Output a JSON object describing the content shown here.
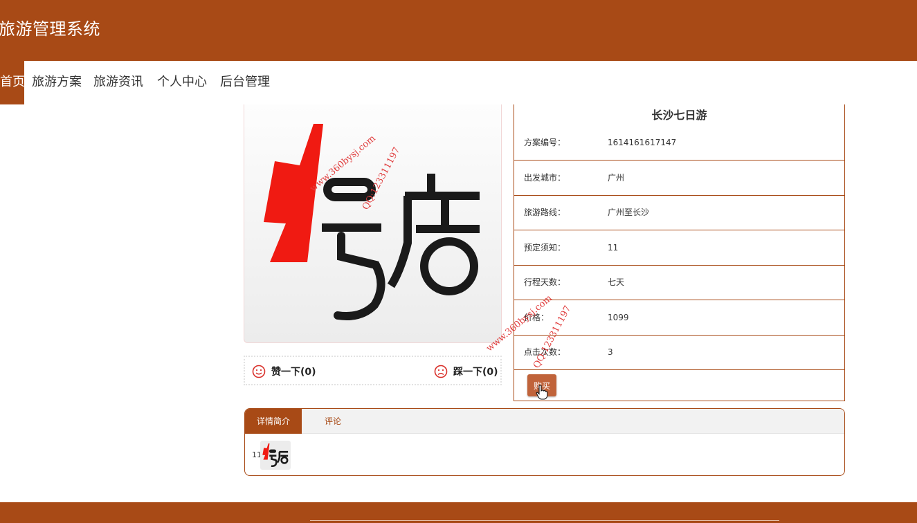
{
  "header": {
    "site_title": "旅游管理系统",
    "accent_color": "#a84a16"
  },
  "nav": {
    "items": [
      {
        "label": "首页",
        "active": true
      },
      {
        "label": "旅游方案",
        "active": false
      },
      {
        "label": "旅游资讯",
        "active": false
      },
      {
        "label": "个人中心",
        "active": false
      },
      {
        "label": "后台管理",
        "active": false
      }
    ]
  },
  "product": {
    "title": "长沙七日游",
    "image_logo": "1号店",
    "fields": [
      {
        "label": "方案编号：",
        "value": "1614161617147"
      },
      {
        "label": "出发城市：",
        "value": "广州"
      },
      {
        "label": "旅游路线：",
        "value": "广州至长沙"
      },
      {
        "label": "预定须知：",
        "value": "11"
      },
      {
        "label": "行程天数：",
        "value": "七天"
      },
      {
        "label": "价格：",
        "value": "1099"
      },
      {
        "label": "点击次数：",
        "value": "3"
      }
    ],
    "buy_label": "购买"
  },
  "votes": {
    "like_label": "赞一下(0)",
    "dislike_label": "踩一下(0)"
  },
  "tabs": {
    "items": [
      {
        "label": "详情简介",
        "active": true
      },
      {
        "label": "评论",
        "active": false
      }
    ],
    "detail_text": "11"
  },
  "watermark": {
    "site": "www.360bysj.com",
    "qq": "QQ:123311197"
  },
  "icons": {
    "like": "smile-face-icon",
    "dislike": "frown-face-icon",
    "cursor": "hand-pointer-icon"
  }
}
